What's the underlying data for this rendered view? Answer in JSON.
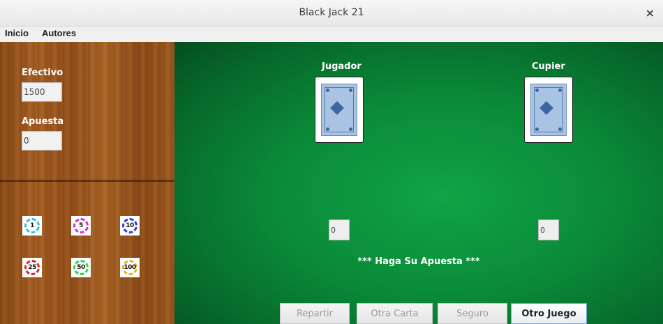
{
  "window": {
    "title": "Black Jack 21",
    "close_label": "×"
  },
  "menu": [
    "Inicio",
    "Autores"
  ],
  "sidebar": {
    "efectivo_label": "Efectivo",
    "efectivo_value": "1500",
    "apuesta_label": "Apuesta",
    "apuesta_value": "0",
    "chips": [
      {
        "value": "1",
        "color": "#2ec4d6"
      },
      {
        "value": "5",
        "color": "#d62ed0"
      },
      {
        "value": "10",
        "color": "#2a3fd6"
      },
      {
        "value": "25",
        "color": "#d62a2a"
      },
      {
        "value": "50",
        "color": "#2ed64a"
      },
      {
        "value": "100",
        "color": "#e6b21e"
      }
    ]
  },
  "table": {
    "player_label": "Jugador",
    "dealer_label": "Cupier",
    "player_count": "0",
    "dealer_count": "0",
    "status": "*** Haga Su Apuesta ***"
  },
  "buttons": {
    "repartir": "Repartir",
    "otra_carta": "Otra Carta",
    "seguro": "Seguro",
    "otro_juego": "Otro Juego"
  }
}
